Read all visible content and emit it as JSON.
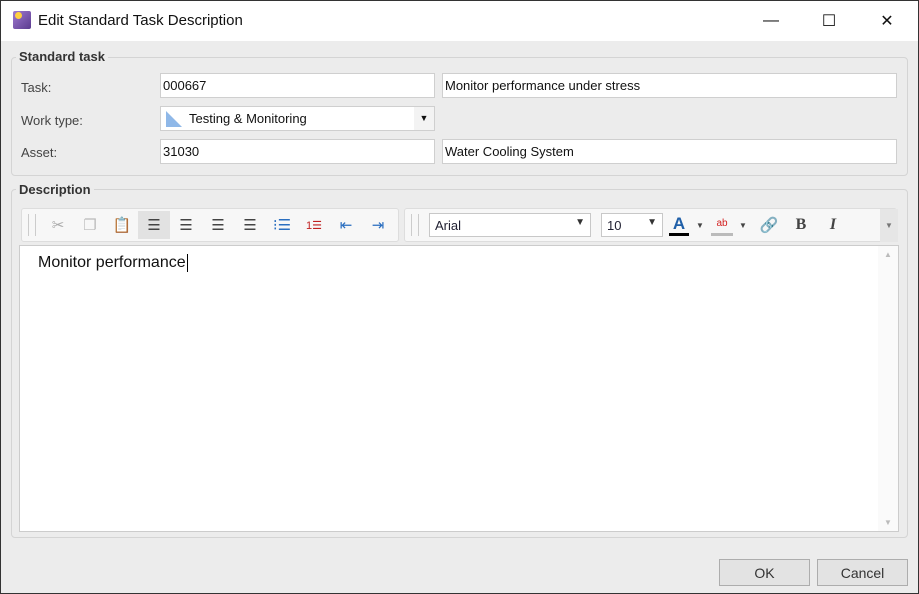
{
  "window": {
    "title": "Edit Standard Task Description",
    "minimize": "—",
    "maximize": "☐",
    "close": "✕"
  },
  "standard_task": {
    "legend": "Standard task",
    "task_label": "Task:",
    "task_code": "000667",
    "task_desc": "Monitor performance under stress",
    "work_type_label": "Work type:",
    "work_type": "Testing & Monitoring",
    "asset_label": "Asset:",
    "asset_code": "31030",
    "asset_desc": "Water Cooling System"
  },
  "description": {
    "legend": "Description",
    "font": "Arial",
    "size": "10",
    "text": "Monitor performance",
    "toolbar_icons": [
      "cut-icon",
      "copy-icon",
      "paste-icon",
      "align-left-icon",
      "align-center-icon",
      "align-right-icon",
      "justify-icon",
      "bullet-list-icon",
      "numbered-list-icon",
      "outdent-icon",
      "indent-icon",
      "font-color-icon",
      "highlight-icon",
      "link-icon",
      "bold-icon",
      "italic-icon"
    ],
    "bold": "B",
    "italic": "I",
    "font_color_glyph": "A",
    "highlight_glyph": "ab"
  },
  "buttons": {
    "ok": "OK",
    "cancel": "Cancel"
  },
  "colors": {
    "accent": "#1f5fa8",
    "highlight": "#d32020"
  }
}
